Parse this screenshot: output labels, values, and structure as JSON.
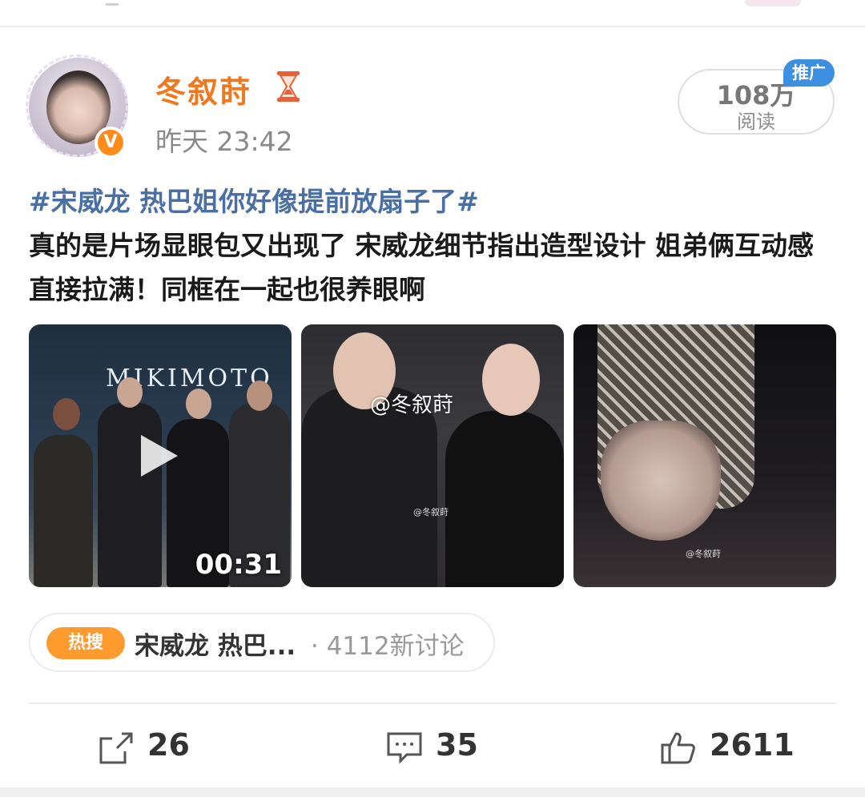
{
  "post": {
    "username": "冬叙莳",
    "time": "昨天 23:42",
    "reads_count": "108万",
    "reads_label": "阅读",
    "promo_tag": "推广",
    "topic": "#宋威龙 热巴姐你好像提前放扇子了#",
    "text": "真的是片场显眼包又出现了 宋威龙细节指出造型设计 姐弟俩互动感直接拉满！同框在一起也很养眼啊"
  },
  "media": {
    "video_duration": "00:31",
    "image1_text": "MIKIMOTO",
    "image2_watermark": "@冬叙莳",
    "image2_small_mark": "@冬叙莳",
    "image3_small_mark": "@冬叙莳"
  },
  "hot_search": {
    "badge": "热搜",
    "title": "宋威龙 热巴...",
    "meta": "· 4112新讨论"
  },
  "actions": {
    "repost": "26",
    "comment": "35",
    "like": "2611"
  },
  "colors": {
    "username": "#f0781e",
    "topic": "#4a6fa5",
    "verified_badge": "#ff8c1a",
    "promo": "#3d8fe0",
    "hot_badge": "#ff9a2e"
  },
  "icons": {
    "verified": "verified-v-icon",
    "member": "hourglass-icon",
    "repost": "share-icon",
    "comment": "comment-icon",
    "like": "thumbs-up-icon",
    "play": "play-icon"
  }
}
